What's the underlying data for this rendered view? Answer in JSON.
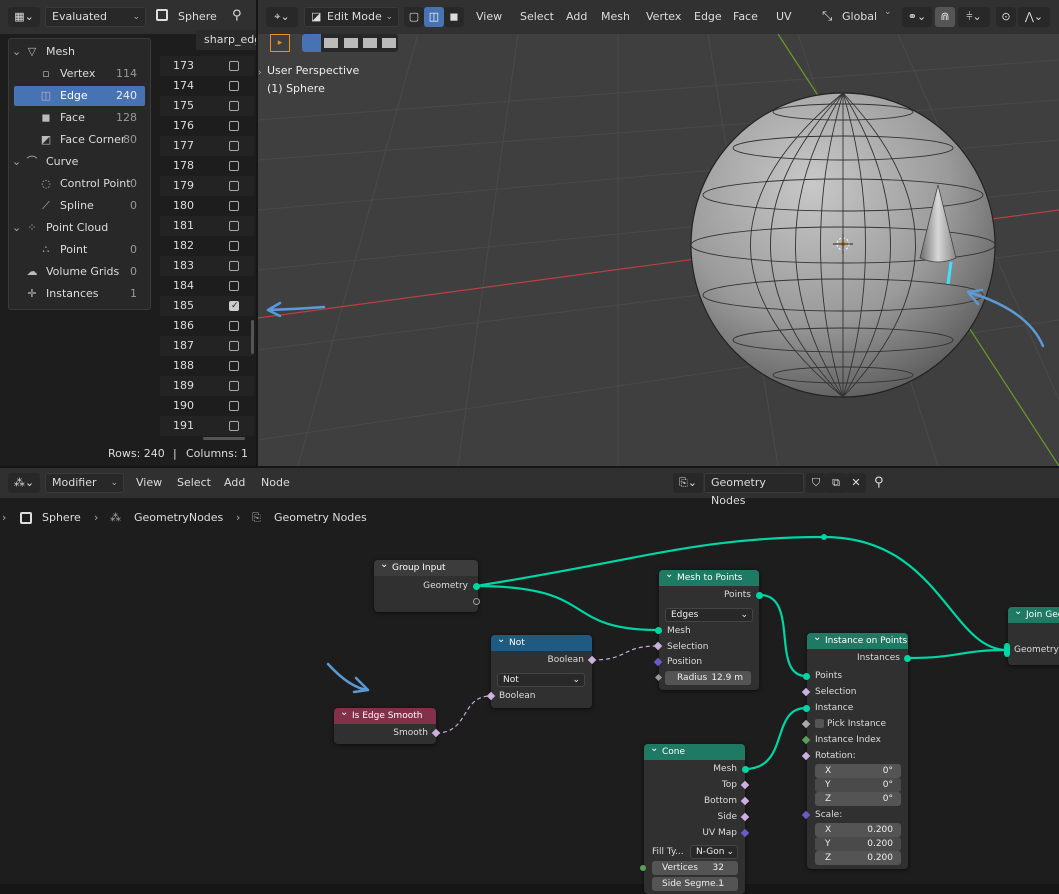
{
  "spreadsheet": {
    "mode": "Evaluated",
    "object": "Sphere",
    "column_header": "sharp_edg",
    "tree": [
      {
        "label": "Mesh",
        "count": "",
        "icon": "mesh-icon",
        "level": 0
      },
      {
        "label": "Vertex",
        "count": "114",
        "icon": "vertex-icon",
        "level": 1
      },
      {
        "label": "Edge",
        "count": "240",
        "icon": "edge-icon",
        "level": 1,
        "selected": true
      },
      {
        "label": "Face",
        "count": "128",
        "icon": "face-icon",
        "level": 1
      },
      {
        "label": "Face Corner",
        "count": "80",
        "icon": "face-corner-icon",
        "level": 1
      },
      {
        "label": "Curve",
        "count": "",
        "icon": "curve-icon",
        "level": 0
      },
      {
        "label": "Control Point",
        "count": "0",
        "icon": "control-point-icon",
        "level": 1
      },
      {
        "label": "Spline",
        "count": "0",
        "icon": "spline-icon",
        "level": 1
      },
      {
        "label": "Point Cloud",
        "count": "",
        "icon": "point-cloud-icon",
        "level": 0
      },
      {
        "label": "Point",
        "count": "0",
        "icon": "point-icon",
        "level": 1
      },
      {
        "label": "Volume Grids",
        "count": "0",
        "icon": "volume-icon",
        "level": 0
      },
      {
        "label": "Instances",
        "count": "1",
        "icon": "instances-icon",
        "level": 0
      }
    ],
    "rows": [
      {
        "n": "173",
        "checked": false
      },
      {
        "n": "174",
        "checked": false
      },
      {
        "n": "175",
        "checked": false
      },
      {
        "n": "176",
        "checked": false
      },
      {
        "n": "177",
        "checked": false
      },
      {
        "n": "178",
        "checked": false
      },
      {
        "n": "179",
        "checked": false
      },
      {
        "n": "180",
        "checked": false
      },
      {
        "n": "181",
        "checked": false
      },
      {
        "n": "182",
        "checked": false
      },
      {
        "n": "183",
        "checked": false
      },
      {
        "n": "184",
        "checked": false
      },
      {
        "n": "185",
        "checked": true
      },
      {
        "n": "186",
        "checked": false
      },
      {
        "n": "187",
        "checked": false
      },
      {
        "n": "188",
        "checked": false
      },
      {
        "n": "189",
        "checked": false
      },
      {
        "n": "190",
        "checked": false
      },
      {
        "n": "191",
        "checked": false
      }
    ],
    "footer_rows": "Rows: 240",
    "footer_sep": "|",
    "footer_cols": "Columns: 1"
  },
  "viewport": {
    "mode": "Edit Mode",
    "menus": [
      "View",
      "Select",
      "Add",
      "Mesh",
      "Vertex",
      "Edge",
      "Face",
      "UV"
    ],
    "transform_orientation": "Global",
    "overlay_line1": "User Perspective",
    "overlay_line2": "(1) Sphere"
  },
  "node_editor": {
    "editor_type": "Modifier",
    "menus": [
      "View",
      "Select",
      "Add",
      "Node"
    ],
    "tree_name": "Geometry Nodes",
    "breadcrumb": [
      "Sphere",
      "GeometryNodes",
      "Geometry Nodes"
    ],
    "nodes": {
      "group_input": {
        "title": "Group Input",
        "out_geometry": "Geometry"
      },
      "mesh_to_points": {
        "title": "Mesh to Points",
        "out_points": "Points",
        "mode": "Edges",
        "in_mesh": "Mesh",
        "in_selection": "Selection",
        "in_position": "Position",
        "radius_label": "Radius",
        "radius_value": "12.9 m"
      },
      "not": {
        "title": "Not",
        "out_boolean": "Boolean",
        "op": "Not",
        "in_boolean": "Boolean"
      },
      "is_edge_smooth": {
        "title": "Is Edge Smooth",
        "out_smooth": "Smooth"
      },
      "instance_on_points": {
        "title": "Instance on Points",
        "out_instances": "Instances",
        "in_points": "Points",
        "in_selection": "Selection",
        "in_instance": "Instance",
        "pick_instance": "Pick Instance",
        "instance_index": "Instance Index",
        "rotation": "Rotation:",
        "rot_x_label": "X",
        "rot_x": "0°",
        "rot_y_label": "Y",
        "rot_y": "0°",
        "rot_z_label": "Z",
        "rot_z": "0°",
        "scale": "Scale:",
        "sc_x_label": "X",
        "sc_x": "0.200",
        "sc_y_label": "Y",
        "sc_y": "0.200",
        "sc_z_label": "Z",
        "sc_z": "0.200"
      },
      "cone": {
        "title": "Cone",
        "out_mesh": "Mesh",
        "out_top": "Top",
        "out_bottom": "Bottom",
        "out_side": "Side",
        "out_uvmap": "UV Map",
        "fill_label": "Fill Ty...",
        "fill_value": "N-Gon",
        "vertices_label": "Vertices",
        "vertices_value": "32",
        "side_label": "Side Segme...",
        "side_value": "1"
      },
      "join_geometry": {
        "title": "Join Geo",
        "in_geometry": "Geometry"
      }
    }
  },
  "colors": {
    "accent": "#4772b3",
    "geometry_socket": "#00d6a3",
    "input_node": "#c3274b",
    "mesh_node": "#1f7a64",
    "utility_node": "#1e5a82"
  }
}
